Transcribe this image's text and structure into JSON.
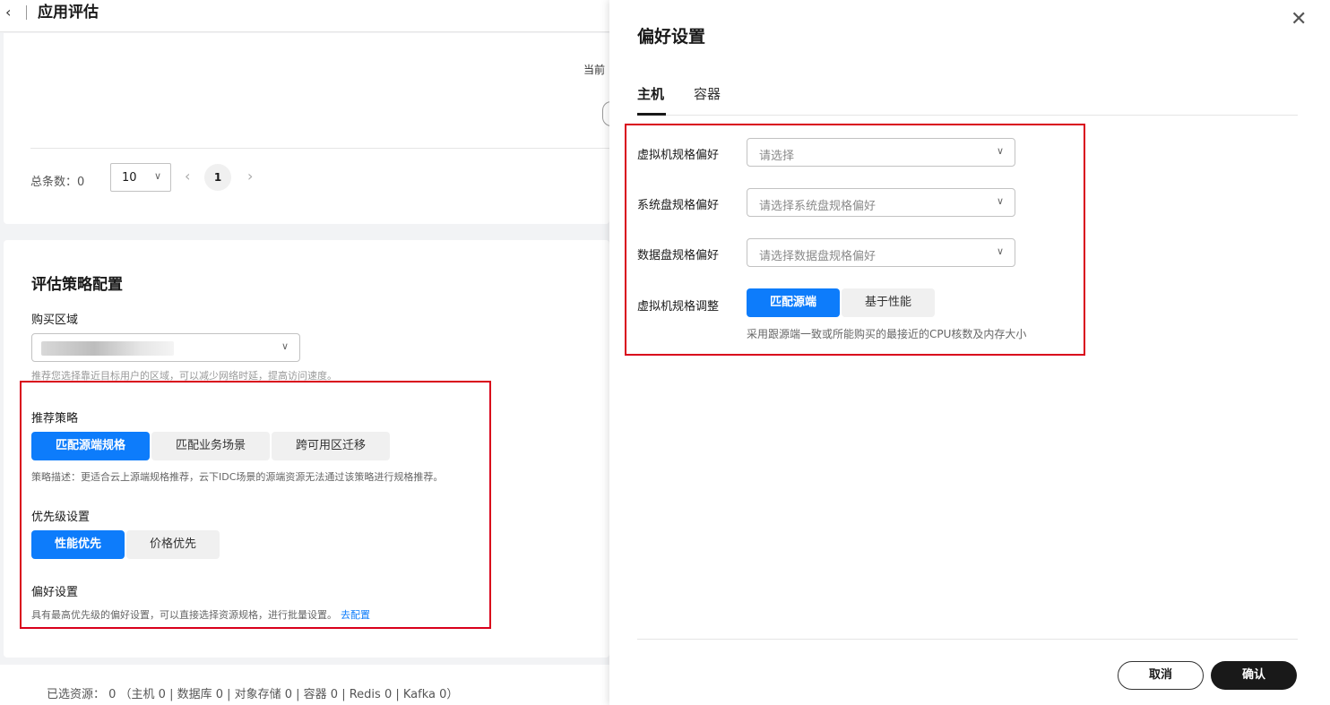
{
  "header": {
    "title": "应用评估"
  },
  "list_card": {
    "truncated_text": "当前",
    "total_label": "总条数：0",
    "page_size": "10",
    "current_page": "1"
  },
  "strategy": {
    "section_title": "评估策略配置",
    "region_label": "购买区域",
    "region_hint": "推荐您选择靠近目标用户的区域，可以减少网络时延，提高访问速度。",
    "recommend_label": "推荐策略",
    "recommend_options": [
      "匹配源端规格",
      "匹配业务场景",
      "跨可用区迁移"
    ],
    "recommend_desc": "策略描述：更适合云上源端规格推荐，云下IDC场景的源端资源无法通过该策略进行规格推荐。",
    "priority_label": "优先级设置",
    "priority_options": [
      "性能优先",
      "价格优先"
    ],
    "preference_label": "偏好设置",
    "preference_desc": "具有最高优先级的偏好设置，可以直接选择资源规格，进行批量设置。",
    "preference_link": "去配置"
  },
  "footer": {
    "selected_text": "已选资源： 0 （主机 0 | 数据库 0 | 对象存储 0 | 容器 0 | Redis 0 | Kafka 0）"
  },
  "drawer": {
    "title": "偏好设置",
    "tabs": [
      "主机",
      "容器"
    ],
    "vm_spec_label": "虚拟机规格偏好",
    "vm_spec_placeholder": "请选择",
    "sys_disk_label": "系统盘规格偏好",
    "sys_disk_placeholder": "请选择系统盘规格偏好",
    "data_disk_label": "数据盘规格偏好",
    "data_disk_placeholder": "请选择数据盘规格偏好",
    "vm_adjust_label": "虚拟机规格调整",
    "vm_adjust_options": [
      "匹配源端",
      "基于性能"
    ],
    "vm_adjust_desc": "采用跟源端一致或所能购买的最接近的CPU核数及内存大小",
    "cancel_label": "取消",
    "ok_label": "确认"
  }
}
